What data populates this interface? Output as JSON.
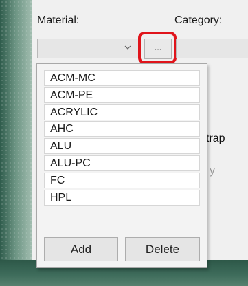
{
  "form": {
    "material_label": "Material:",
    "category_label": "Category:",
    "browse_button_label": "...",
    "background_text_1": "trap",
    "background_text_2": "y"
  },
  "dropdown": {
    "items": [
      "ACM-MC",
      "ACM-PE",
      "ACRYLIC",
      "AHC",
      "ALU",
      "ALU-PC",
      "FC",
      "HPL"
    ],
    "add_label": "Add",
    "delete_label": "Delete"
  },
  "colors": {
    "highlight": "#e0141b",
    "background_green": "#3f6d5c",
    "panel": "#f0f0f0"
  },
  "icons": {
    "combo_arrow": "chevron-down-icon"
  }
}
